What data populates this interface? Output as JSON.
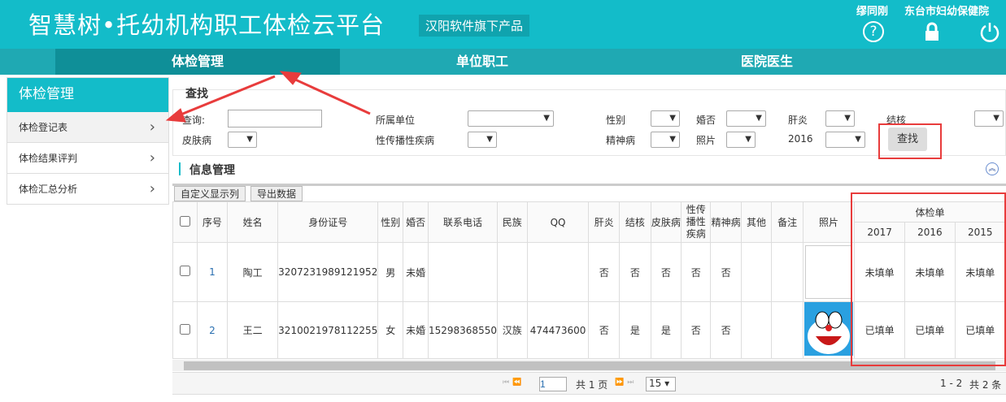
{
  "header": {
    "title": "智慧树•托幼机构职工体检云平台",
    "badge": "汉阳软件旗下产品",
    "user": "缪同刚",
    "org": "东台市妇幼保健院",
    "icons": [
      "help-icon",
      "lock-icon",
      "power-icon"
    ]
  },
  "nav": {
    "tabs": [
      {
        "label": "体检管理",
        "active": true
      },
      {
        "label": "单位职工"
      },
      {
        "label": "医院医生"
      }
    ]
  },
  "sidebar": {
    "title": "体检管理",
    "items": [
      {
        "label": "体检登记表",
        "selected": true
      },
      {
        "label": "体检结果评判"
      },
      {
        "label": "体检汇总分析"
      }
    ]
  },
  "search": {
    "title": "查找",
    "query_label": "查询:",
    "query_value": "",
    "unit_label": "所属单位",
    "gender_label": "性别",
    "marriage_label": "婚否",
    "hepatitis_label": "肝炎",
    "tb_label": "结核",
    "skin_label": "皮肤病",
    "std_label": "性传播性疾病",
    "mental_label": "精神病",
    "photo_label": "照片",
    "year_label": "2016",
    "button": "查找"
  },
  "info": {
    "title": "信息管理",
    "custom_cols": "自定义显示列",
    "export": "导出数据"
  },
  "table": {
    "headers": [
      "序号",
      "姓名",
      "身份证号",
      "性别",
      "婚否",
      "联系电话",
      "民族",
      "QQ",
      "肝炎",
      "结核",
      "皮肤病",
      "性传播性疾病",
      "精神病",
      "其他",
      "备注",
      "照片"
    ],
    "group_header": "体检单",
    "years": [
      "2017",
      "2016",
      "2015"
    ],
    "rows": [
      {
        "no": "1",
        "name": "陶工",
        "id": "3207231989121952",
        "gender": "男",
        "married": "未婚",
        "phone": "",
        "ethnic": "",
        "qq": "",
        "hep": "否",
        "tb": "否",
        "skin": "否",
        "std": "否",
        "mental": "否",
        "other": "",
        "note": "",
        "y2017": "未填单",
        "y2016": "未填单",
        "y2015": "未填单"
      },
      {
        "no": "2",
        "name": "王二",
        "id": "3210021978112255",
        "gender": "女",
        "married": "未婚",
        "phone": "15298368550",
        "ethnic": "汉族",
        "qq": "474473600",
        "hep": "否",
        "tb": "是",
        "skin": "是",
        "std": "否",
        "mental": "否",
        "other": "",
        "note": "",
        "y2017": "已填单",
        "y2016": "已填单",
        "y2015": "已填单"
      }
    ]
  },
  "pager": {
    "page": "1",
    "total_pages": "共 1 页",
    "page_size": "15",
    "range": "1 - 2",
    "total": "共 2 条"
  },
  "colors": {
    "primary": "#13bcc9",
    "nav": "#1fa9b3",
    "nav_active": "#0f8f98",
    "annotation": "#e83c3c"
  }
}
